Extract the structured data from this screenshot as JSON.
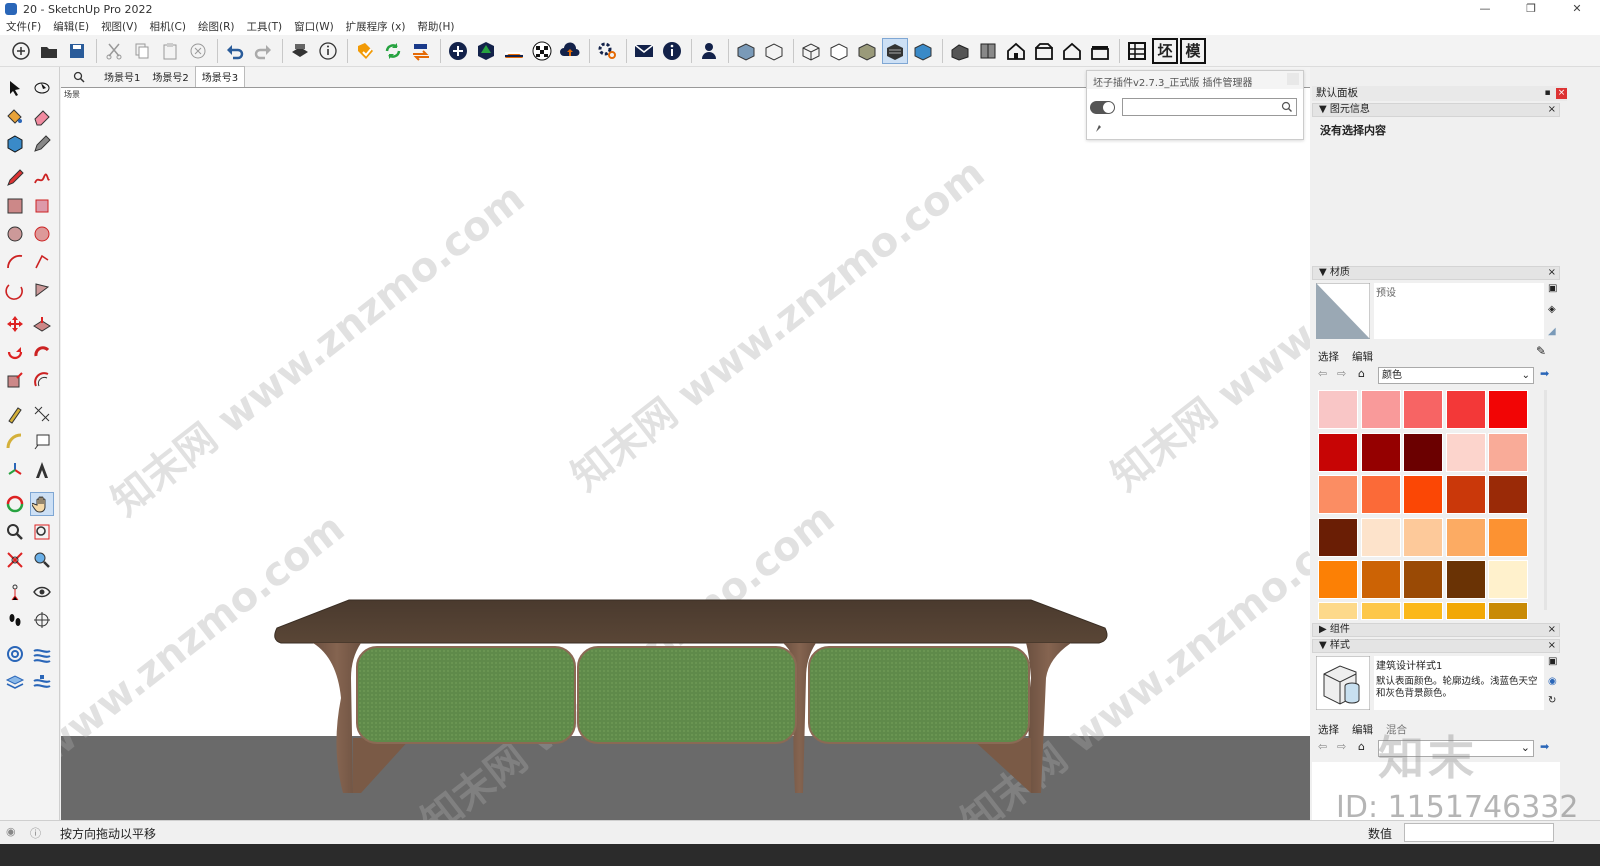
{
  "window": {
    "title": "20 - SketchUp Pro 2022",
    "buttons": [
      "—",
      "❐",
      "✕"
    ]
  },
  "menu": [
    "文件(F)",
    "编辑(E)",
    "视图(V)",
    "相机(C)",
    "绘图(R)",
    "工具(T)",
    "窗口(W)",
    "扩展程序 (x)",
    "帮助(H)"
  ],
  "toolbar": {
    "text_buttons": [
      "坯",
      "模"
    ]
  },
  "scenes": {
    "tabs": [
      "场景号1",
      "场景号2",
      "场景号3"
    ],
    "active_index": 2
  },
  "viewport": {
    "corner_label": "场景",
    "watermark": "知末网 www.znzmo.com"
  },
  "plugin": {
    "title": "坯子插件v2.7.3_正式版 插件管理器",
    "search_value": ""
  },
  "tray": {
    "title": "默认面板",
    "entity_info": {
      "header": "图元信息",
      "body": "没有选择内容"
    },
    "materials": {
      "header": "材质",
      "preset": "预设",
      "tab_select": "选择",
      "tab_edit": "编辑",
      "library": "颜色",
      "swatches": [
        "#f9c6c6",
        "#f99a9a",
        "#f76464",
        "#f33838",
        "#f20505",
        "#c70505",
        "#950000",
        "#6b0000",
        "#fcd4cc",
        "#f9ab98",
        "#fb8d63",
        "#fb6a38",
        "#fb4705",
        "#ca380a",
        "#9a2a07",
        "#6a1e05",
        "#fde3cb",
        "#fdc99a",
        "#fcab63",
        "#fc9232",
        "#fc8005",
        "#cc6305",
        "#9a4a05",
        "#6a3305",
        "#fff1cc"
      ]
    },
    "components": {
      "header": "组件"
    },
    "styles": {
      "header": "样式",
      "name": "建筑设计样式1",
      "description": "默认表面颜色。轮廓边线。浅蓝色天空和灰色背景颜色。",
      "tab_select": "选择",
      "tab_edit": "编辑",
      "tab_mix": "混合"
    }
  },
  "status": {
    "message": "按方向拖动以平移",
    "value_label": "数值",
    "value": ""
  },
  "overlay": {
    "id_text": "ID: 1151746332",
    "logo_text": "知末"
  }
}
